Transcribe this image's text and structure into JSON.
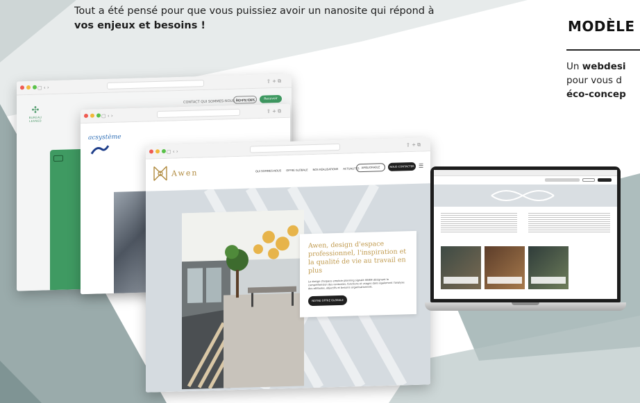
{
  "tagline": {
    "line1": "Tout a été pensé pour que vous puissiez avoir un nanosite qui répond à",
    "line2_bold": "vos enjeux et besoins !"
  },
  "side": {
    "title": "MODÈLE",
    "line1_prefix": "Un ",
    "line1_bold": "webdesi",
    "line2": "pour vous d",
    "line3_bold": "éco-concep"
  },
  "window_front": {
    "brand": "Awen",
    "nav": [
      "QUI SOMMES-NOUS",
      "OFFRE GLOBALE",
      "NOS RÉALISATIONS",
      "ACTUALITÉS"
    ],
    "btn_outline": "AMÉLIORABLE",
    "btn_dark": "NOUS CONTACTER",
    "hero_title": "Awen, design d'espace professionnel, l'inspiration et la qualité de vie au travail en plus",
    "hero_text": "Le design d'espace emploie planning signalé AWEN désignant la compréhension des contextes, fonctions et usages dans également l'analyse des attitudes, objectifs et besoins organisationnels.",
    "hero_button": "NOTRE OFFRE GLOBALE"
  },
  "window_second": {
    "brand": "acsystème"
  },
  "window_back": {
    "brand": "BUREAU LEANED",
    "nav": "CONTACT  QUI SOMMES-NOUS  AU FIL DES",
    "btn1": "Réservation",
    "btn2": "Recevoir l'offre"
  },
  "icons": {
    "dots": [
      "close-dot",
      "minimize-dot",
      "maximize-dot"
    ],
    "menu": "hamburger-icon"
  },
  "colors": {
    "accent_gold": "#c09a4e",
    "brand_green": "#3f9a62",
    "acsys_blue": "#2f6fb6",
    "backdrop_slate": "#8fa2a3"
  }
}
